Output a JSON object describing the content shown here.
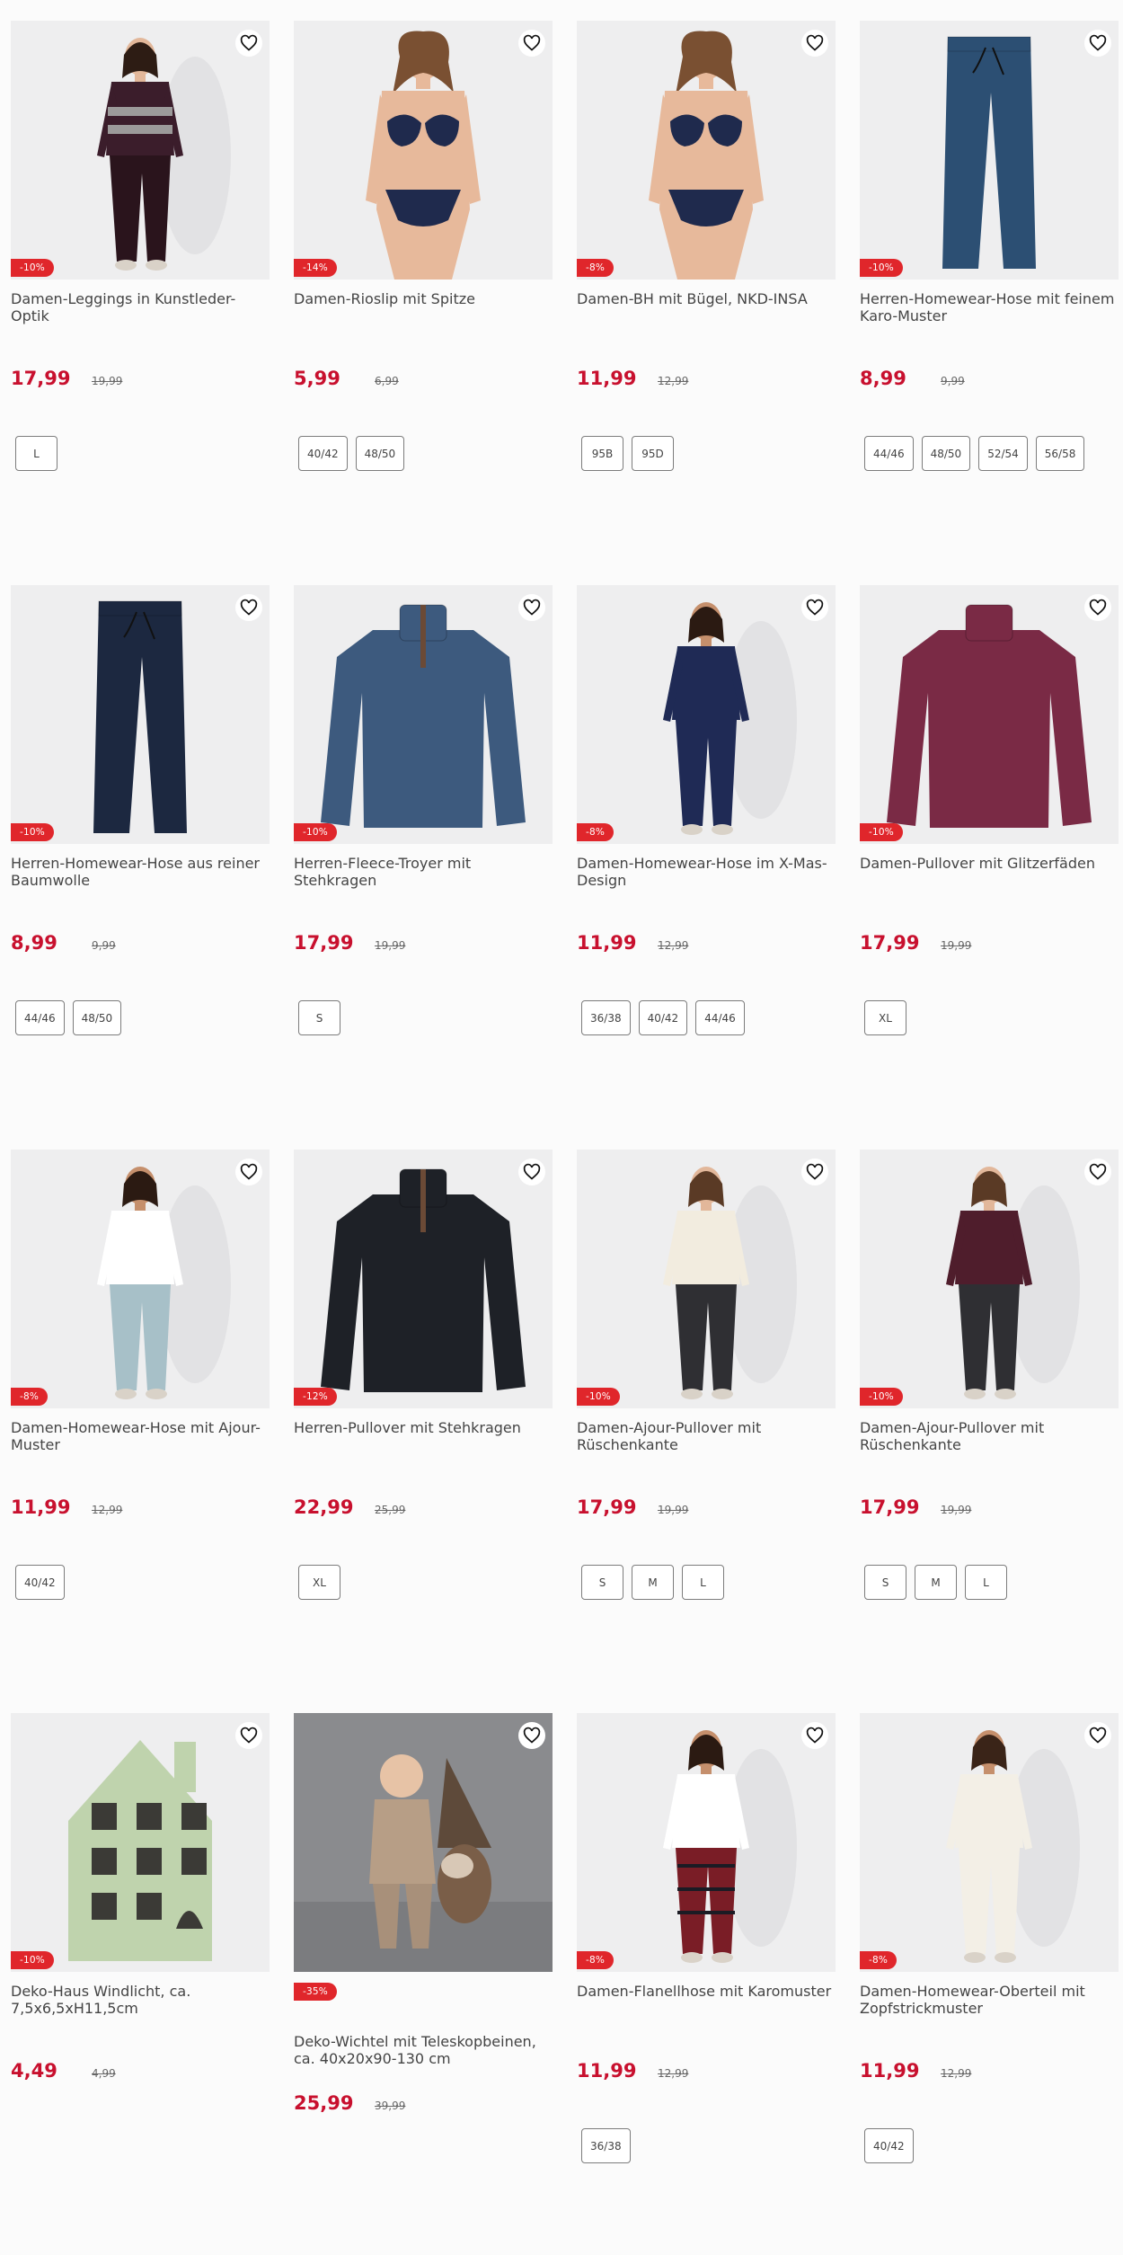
{
  "products": [
    {
      "name": "Damen-Leggings in Kunstleder-Optik",
      "discount": "-10%",
      "price": "17,99",
      "old_price": "19,99",
      "sizes": [
        "L"
      ],
      "image": "woman-leggings-sweater"
    },
    {
      "name": "Damen-Rioslip mit Spitze",
      "discount": "-14%",
      "price": "5,99",
      "old_price": "6,99",
      "sizes": [
        "40/42",
        "48/50"
      ],
      "image": "woman-lingerie"
    },
    {
      "name": "Damen-BH mit Bügel, NKD-INSA",
      "discount": "-8%",
      "price": "11,99",
      "old_price": "12,99",
      "sizes": [
        "95B",
        "95D"
      ],
      "image": "woman-lingerie"
    },
    {
      "name": "Herren-Homewear-Hose mit feinem Karo-Muster",
      "discount": "-10%",
      "price": "8,99",
      "old_price": "9,99",
      "sizes": [
        "44/46",
        "48/50",
        "52/54",
        "56/58"
      ],
      "image": "blue-trousers"
    },
    {
      "name": "Herren-Homewear-Hose aus reiner Baumwolle",
      "discount": "-10%",
      "price": "8,99",
      "old_price": "9,99",
      "sizes": [
        "44/46",
        "48/50"
      ],
      "image": "navy-trousers"
    },
    {
      "name": "Herren-Fleece-Troyer mit Stehkragen",
      "discount": "-10%",
      "price": "17,99",
      "old_price": "19,99",
      "sizes": [
        "S"
      ],
      "image": "blue-fleece"
    },
    {
      "name": "Damen-Homewear-Hose im X-Mas-Design",
      "discount": "-8%",
      "price": "11,99",
      "old_price": "12,99",
      "sizes": [
        "36/38",
        "40/42",
        "44/46"
      ],
      "image": "woman-navy-homewear"
    },
    {
      "name": "Damen-Pullover mit Glitzerfäden",
      "discount": "-10%",
      "price": "17,99",
      "old_price": "19,99",
      "sizes": [
        "XL"
      ],
      "image": "burgundy-sweater"
    },
    {
      "name": "Damen-Homewear-Hose mit Ajour-Muster",
      "discount": "-8%",
      "price": "11,99",
      "old_price": "12,99",
      "sizes": [
        "40/42"
      ],
      "image": "woman-light-blue-pants"
    },
    {
      "name": "Herren-Pullover mit Stehkragen",
      "discount": "-12%",
      "price": "22,99",
      "old_price": "25,99",
      "sizes": [
        "XL"
      ],
      "image": "black-troyer"
    },
    {
      "name": "Damen-Ajour-Pullover mit Rüschenkante",
      "discount": "-10%",
      "price": "17,99",
      "old_price": "19,99",
      "sizes": [
        "S",
        "M",
        "L"
      ],
      "image": "woman-cream-sweater"
    },
    {
      "name": "Damen-Ajour-Pullover mit Rüschenkante",
      "discount": "-10%",
      "price": "17,99",
      "old_price": "19,99",
      "sizes": [
        "S",
        "M",
        "L"
      ],
      "image": "woman-burgundy-sweater"
    },
    {
      "name": "Deko-Haus Windlicht, ca. 7,5x6,5xH11,5cm",
      "discount": "-10%",
      "price": "4,49",
      "old_price": "4,99",
      "sizes": [],
      "image": "green-ceramic-house"
    },
    {
      "name": "Deko-Wichtel mit Teleskopbeinen, ca. 40x20x90-130 cm",
      "discount": "-35%",
      "price": "25,99",
      "old_price": "39,99",
      "sizes": [],
      "image": "child-with-gnome"
    },
    {
      "name": "Damen-Flanellhose mit Karomuster",
      "discount": "-8%",
      "price": "11,99",
      "old_price": "12,99",
      "sizes": [
        "36/38"
      ],
      "image": "woman-plaid-pants"
    },
    {
      "name": "Damen-Homewear-Oberteil mit Zopfstrickmuster",
      "discount": "-8%",
      "price": "11,99",
      "old_price": "12,99",
      "sizes": [
        "40/42"
      ],
      "image": "woman-white-knit"
    }
  ],
  "colors": {
    "accent": "#c8102e",
    "badge": "#e0262b",
    "background": "#fbfbfb"
  },
  "icons": {
    "wishlist": "heart-outline-icon"
  }
}
